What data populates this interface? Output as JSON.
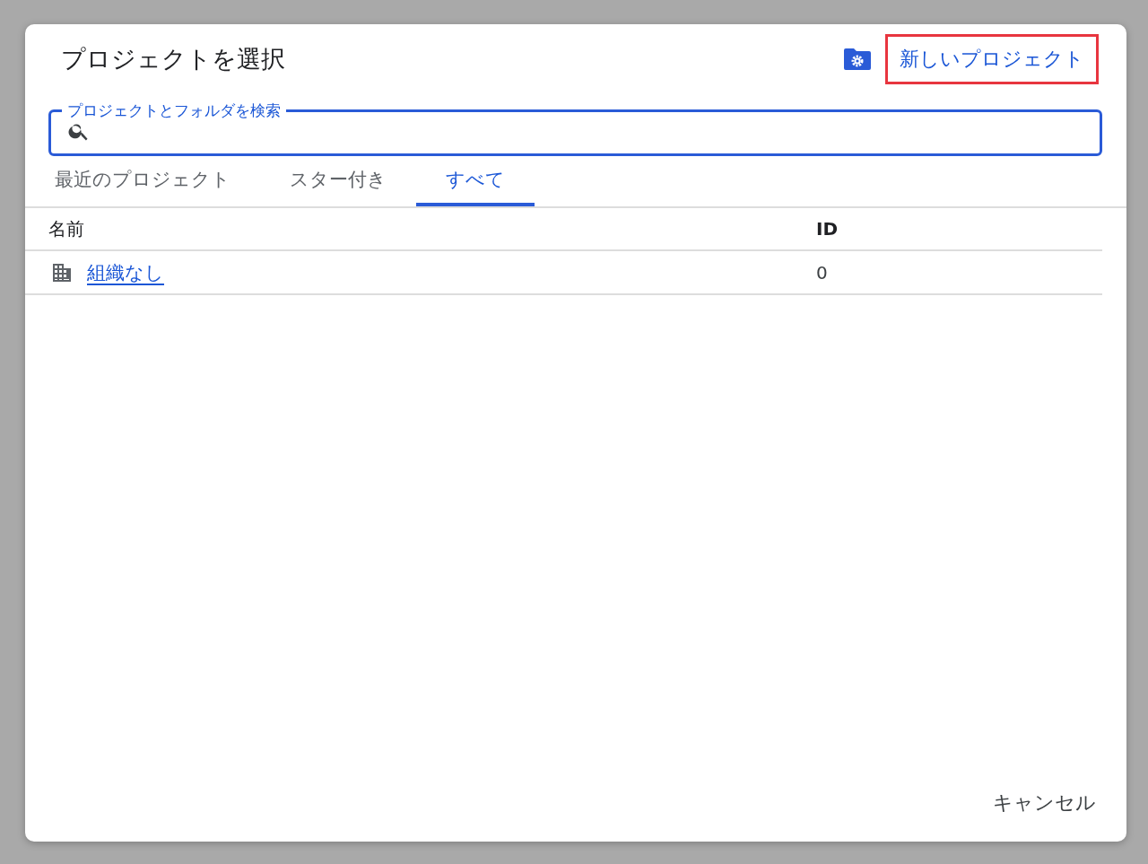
{
  "dialog": {
    "title": "プロジェクトを選択",
    "new_project": {
      "label": "新しいプロジェクト",
      "highlighted": true
    }
  },
  "search": {
    "label": "プロジェクトとフォルダを検索"
  },
  "tabs": [
    {
      "label": "最近のプロジェクト",
      "selected": false
    },
    {
      "label": "スター付き",
      "selected": false
    },
    {
      "label": "すべて",
      "selected": true
    }
  ],
  "table": {
    "columns": [
      "名前",
      "ID"
    ],
    "rows": [
      {
        "name": "組織なし",
        "id": "0"
      }
    ]
  },
  "buttons": {
    "cancel": "キャンセル"
  }
}
